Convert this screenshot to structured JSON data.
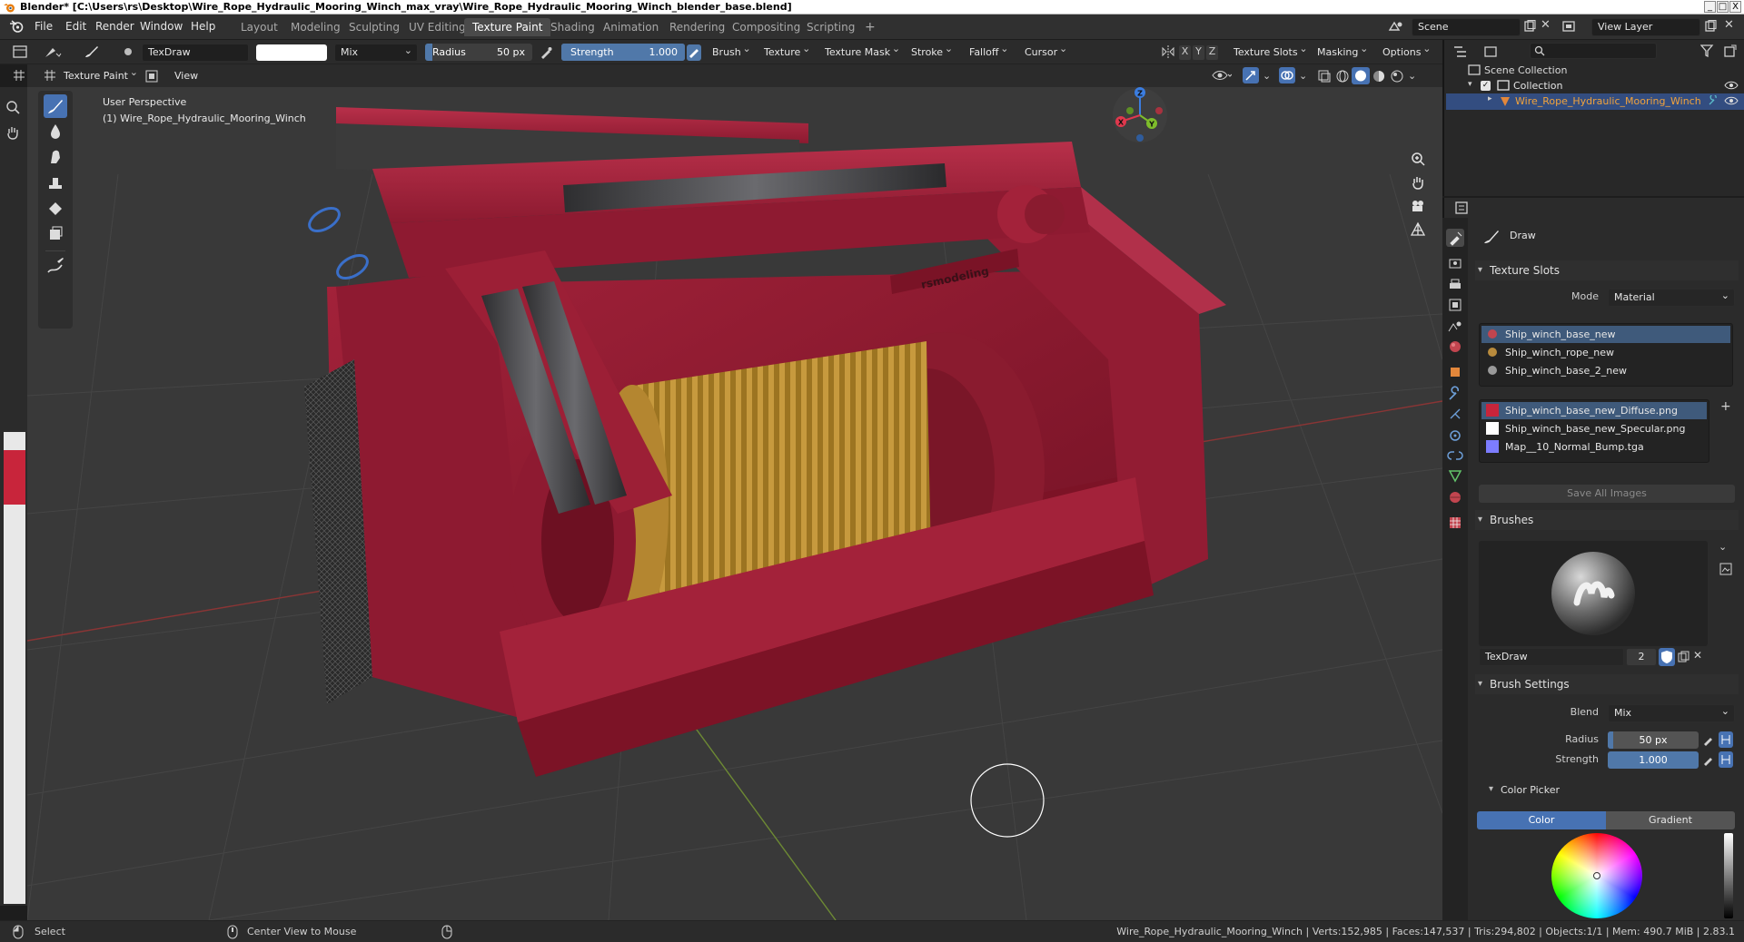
{
  "window": {
    "title": "Blender* [C:\\Users\\rs\\Desktop\\Wire_Rope_Hydraulic_Mooring_Winch_max_vray\\Wire_Rope_Hydraulic_Mooring_Winch_blender_base.blend]",
    "controls": [
      "_",
      "□",
      "X"
    ]
  },
  "menubar": {
    "menus": [
      "File",
      "Edit",
      "Render",
      "Window",
      "Help"
    ],
    "workspaces": [
      "Layout",
      "Modeling",
      "Sculpting",
      "UV Editing",
      "Texture Paint",
      "Shading",
      "Animation",
      "Rendering",
      "Compositing",
      "Scripting"
    ],
    "active_workspace": "Texture Paint",
    "add_tab": "+",
    "scene": "Scene",
    "view_layer": "View Layer"
  },
  "tool_header": {
    "brush_name": "TexDraw",
    "color_swatch": "#ffffff",
    "blend_mode": "Mix",
    "radius_label": "Radius",
    "radius_value": "50 px",
    "strength_label": "Strength",
    "strength_value": "1.000",
    "strength_fraction": 1.0,
    "menus": [
      "Brush",
      "Texture",
      "Texture Mask",
      "Stroke",
      "Falloff",
      "Cursor"
    ],
    "axes": [
      "X",
      "Y",
      "Z"
    ],
    "right_menus": [
      "Texture Slots",
      "Masking",
      "Options"
    ]
  },
  "view_header": {
    "mode": "Texture Paint",
    "view_menu": "View"
  },
  "viewport": {
    "perspective_label": "User Perspective",
    "object_label": "(1) Wire_Rope_Hydraulic_Mooring_Winch",
    "logo_text": "rsmodeling",
    "gizmo_axes": [
      "Z",
      "Y",
      "X"
    ],
    "accent_red": "#9c1b2e"
  },
  "outliner": {
    "scene_collection": "Scene Collection",
    "collection": "Collection",
    "object": "Wire_Rope_Hydraulic_Mooring_Winch"
  },
  "properties": {
    "tool_name": "Draw",
    "texture_slots": {
      "header": "Texture Slots",
      "mode_label": "Mode",
      "mode_value": "Material",
      "materials": [
        "Ship_winch_base_new",
        "Ship_winch_rope_new",
        "Ship_winch_base_2_new"
      ],
      "images": [
        "Ship_winch_base_new_Diffuse.png",
        "Ship_winch_base_new_Specular.png",
        "Map__10_Normal_Bump.tga"
      ],
      "save_all": "Save All Images"
    },
    "brushes": {
      "header": "Brushes",
      "brush_name": "TexDraw",
      "users": "2"
    },
    "brush_settings": {
      "header": "Brush Settings",
      "blend_label": "Blend",
      "blend_value": "Mix",
      "radius_label": "Radius",
      "radius_value": "50 px",
      "strength_label": "Strength",
      "strength_value": "1.000"
    },
    "color_picker": {
      "header": "Color Picker",
      "tab_color": "Color",
      "tab_gradient": "Gradient"
    }
  },
  "statusbar": {
    "left_action": "Select",
    "middle_action": "Center View to Mouse",
    "stats": "Wire_Rope_Hydraulic_Mooring_Winch | Verts:152,985 | Faces:147,537 | Tris:294,802 | Objects:1/1 | Mem: 490.7 MiB | 2.83.1"
  }
}
